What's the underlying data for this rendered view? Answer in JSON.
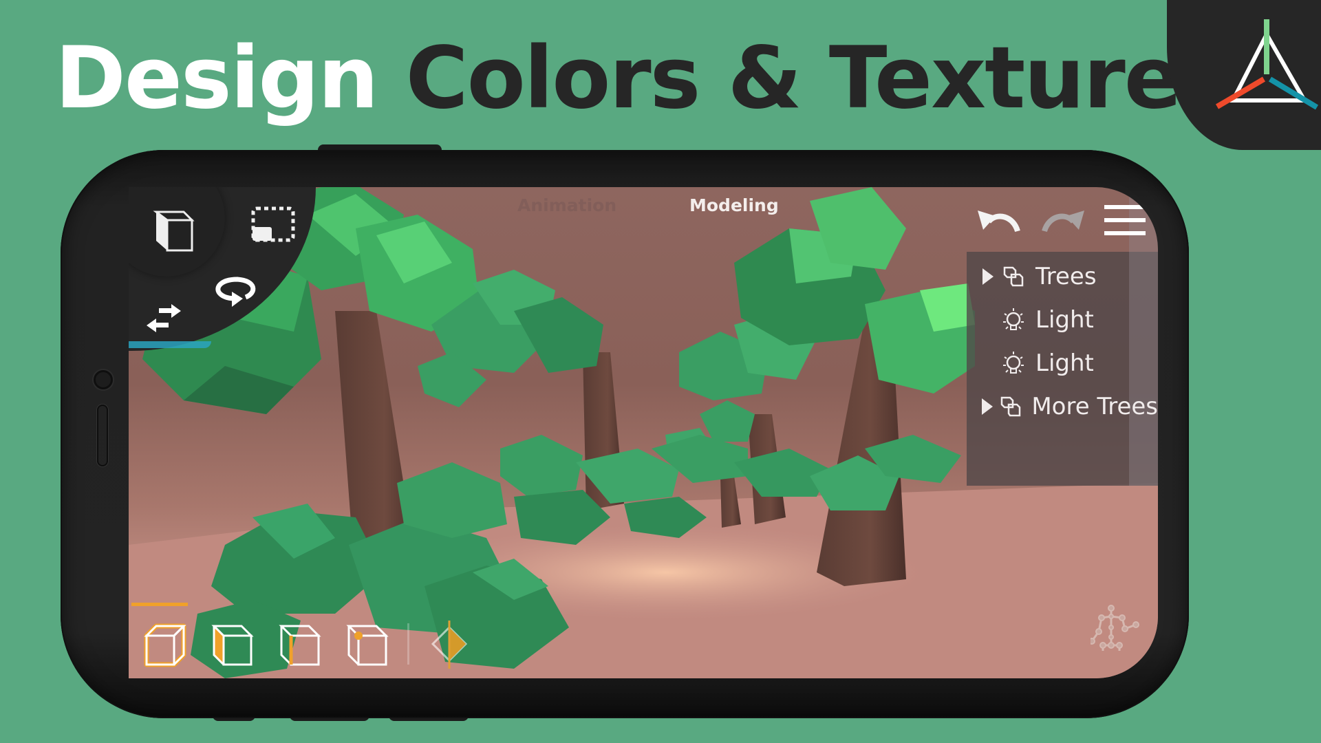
{
  "headline": {
    "word1": "Design",
    "word2": "Colors & Textures",
    "word1_color": "#ffffff",
    "word2_color": "#262626"
  },
  "background_color": "#59a981",
  "logo": {
    "name": "tetrahedron-axis-logo",
    "axis_colors": {
      "y": "#7fd48e",
      "x": "#ef4a2b",
      "z": "#1493a8"
    }
  },
  "app": {
    "mode_tabs": [
      {
        "label": "Animation",
        "active": false
      },
      {
        "label": "Modeling",
        "active": true
      }
    ],
    "corner_tools": [
      {
        "icon": "cube-object-icon",
        "label": "Object mode"
      },
      {
        "icon": "box-select-icon",
        "label": "Selection"
      },
      {
        "icon": "rotate-icon",
        "label": "Rotate"
      },
      {
        "icon": "swap-arrows-icon",
        "label": "Move"
      }
    ],
    "top_right_tools": [
      {
        "icon": "undo-icon",
        "label": "Undo",
        "enabled": true
      },
      {
        "icon": "redo-icon",
        "label": "Redo",
        "enabled": false
      },
      {
        "icon": "hamburger-menu-icon",
        "label": "Menu",
        "enabled": true
      }
    ],
    "outliner": {
      "items": [
        {
          "label": "Trees",
          "type": "group",
          "icon": "group-cubes-icon",
          "expandable": true
        },
        {
          "label": "Light",
          "type": "light",
          "icon": "lightbulb-icon",
          "expandable": false
        },
        {
          "label": "Light",
          "type": "light",
          "icon": "lightbulb-icon",
          "expandable": false
        },
        {
          "label": "More Trees",
          "type": "group",
          "icon": "group-cubes-icon",
          "expandable": true
        }
      ]
    },
    "select_modes": [
      {
        "icon": "object-select-mode-icon",
        "label": "Object",
        "active": true
      },
      {
        "icon": "face-select-mode-icon",
        "label": "Face",
        "active": false
      },
      {
        "icon": "edge-select-mode-icon",
        "label": "Edge",
        "active": false
      },
      {
        "icon": "vertex-select-mode-icon",
        "label": "Vertex",
        "active": false
      },
      {
        "icon": "symmetry-diamond-icon",
        "label": "Symmetry",
        "active": false
      }
    ],
    "accent_color": "#f0a12a",
    "rig_tool": {
      "icon": "skeleton-rig-icon",
      "label": "Armature"
    }
  }
}
